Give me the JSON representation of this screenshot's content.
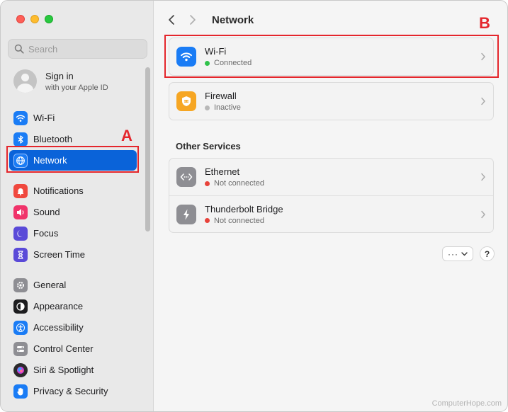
{
  "window": {
    "traffic_lights": [
      "close",
      "minimize",
      "zoom"
    ]
  },
  "sidebar": {
    "search": {
      "placeholder": "Search",
      "value": ""
    },
    "account": {
      "title": "Sign in",
      "subtitle": "with your Apple ID"
    },
    "items": [
      {
        "label": "Wi-Fi",
        "icon": "wifi-icon",
        "color": "#1a7cf5"
      },
      {
        "label": "Bluetooth",
        "icon": "bluetooth-icon",
        "color": "#1a7cf5"
      },
      {
        "label": "Network",
        "icon": "globe-icon",
        "color": "#1a7cf5",
        "selected": true
      },
      {
        "label": "Notifications",
        "icon": "bell-icon",
        "color": "#f0483e"
      },
      {
        "label": "Sound",
        "icon": "speaker-icon",
        "color": "#f0336a"
      },
      {
        "label": "Focus",
        "icon": "moon-icon",
        "color": "#5a4ad8"
      },
      {
        "label": "Screen Time",
        "icon": "hourglass-icon",
        "color": "#5a4ad8"
      },
      {
        "label": "General",
        "icon": "gear-icon",
        "color": "#8e8e93"
      },
      {
        "label": "Appearance",
        "icon": "appearance-icon",
        "color": "#1d1d1f"
      },
      {
        "label": "Accessibility",
        "icon": "accessibility-icon",
        "color": "#1a7cf5"
      },
      {
        "label": "Control Center",
        "icon": "control-center-icon",
        "color": "#8e8e93"
      },
      {
        "label": "Siri & Spotlight",
        "icon": "siri-icon",
        "color": "#2b2b2b"
      },
      {
        "label": "Privacy & Security",
        "icon": "hand-icon",
        "color": "#1a7cf5"
      }
    ]
  },
  "annotations": {
    "a": "A",
    "b": "B"
  },
  "main": {
    "title": "Network",
    "services": [
      {
        "name": "Wi-Fi",
        "status": "Connected",
        "status_color": "#30c24b",
        "icon": "wifi-icon",
        "color": "#1a7cf5"
      },
      {
        "name": "Firewall",
        "status": "Inactive",
        "status_color": "#b8b8b8",
        "icon": "firewall-icon",
        "color": "#f6a623"
      }
    ],
    "other_services_title": "Other Services",
    "other_services": [
      {
        "name": "Ethernet",
        "status": "Not connected",
        "status_color": "#e8423a",
        "icon": "ethernet-icon",
        "color": "#8e8e93"
      },
      {
        "name": "Thunderbolt Bridge",
        "status": "Not connected",
        "status_color": "#e8423a",
        "icon": "thunderbolt-icon",
        "color": "#8e8e93"
      }
    ],
    "more_button": "···",
    "help_button": "?"
  },
  "watermark": "ComputerHope.com"
}
